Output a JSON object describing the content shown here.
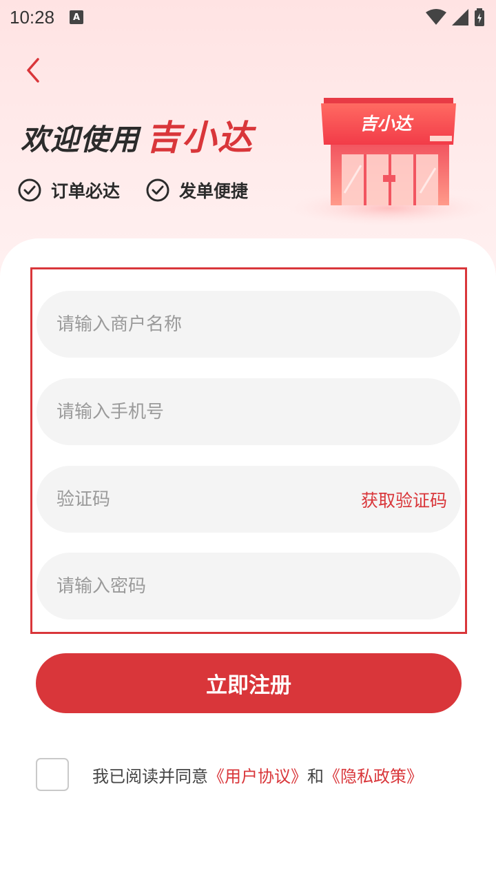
{
  "status_bar": {
    "time": "10:28",
    "notification_letter": "A"
  },
  "header": {
    "welcome": "欢迎使用",
    "brand": "吉小达",
    "store_sign": "吉小达",
    "features": [
      {
        "label": "订单必达"
      },
      {
        "label": "发单便捷"
      }
    ]
  },
  "form": {
    "merchant_placeholder": "请输入商户名称",
    "phone_placeholder": "请输入手机号",
    "code_placeholder": "验证码",
    "get_code_label": "获取验证码",
    "password_placeholder": "请输入密码"
  },
  "submit_label": "立即注册",
  "agreement": {
    "prefix": "我已阅读并同意",
    "user_agreement": "《用户协议》",
    "conjunction": "和",
    "privacy_policy": "《隐私政策》"
  },
  "colors": {
    "accent": "#d9363a",
    "hero_bg": "#ffe3e3",
    "field_bg": "#f4f4f4"
  }
}
